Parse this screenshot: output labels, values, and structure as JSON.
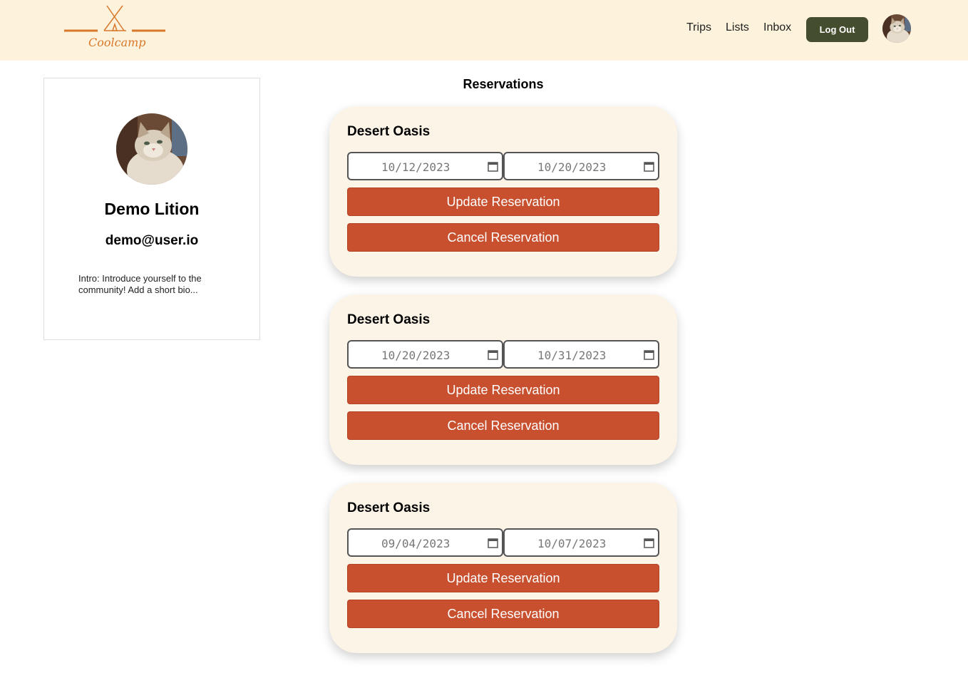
{
  "header": {
    "logo_text": "Coolcamp",
    "nav": [
      "Trips",
      "Lists",
      "Inbox"
    ],
    "logout_label": "Log Out"
  },
  "profile": {
    "name": "Demo Lition",
    "email": "demo@user.io",
    "intro": "Intro: Introduce yourself to the community! Add a short bio..."
  },
  "reservations": {
    "heading": "Reservations",
    "items": [
      {
        "title": "Desert Oasis",
        "start": "10/12/2023",
        "end": "10/20/2023",
        "update_label": "Update Reservation",
        "cancel_label": "Cancel Reservation"
      },
      {
        "title": "Desert Oasis",
        "start": "10/20/2023",
        "end": "10/31/2023",
        "update_label": "Update Reservation",
        "cancel_label": "Cancel Reservation"
      },
      {
        "title": "Desert Oasis",
        "start": "09/04/2023",
        "end": "10/07/2023",
        "update_label": "Update Reservation",
        "cancel_label": "Cancel Reservation"
      }
    ]
  },
  "colors": {
    "header_bg": "#fdf2dc",
    "brand_orange": "#d9782b",
    "logout_bg": "#444d2e",
    "button_red": "#c8502e",
    "card_bg": "#fdf4e8"
  },
  "icons": [
    "tent-logo-icon",
    "calendar-icon",
    "avatar-cat-image"
  ]
}
